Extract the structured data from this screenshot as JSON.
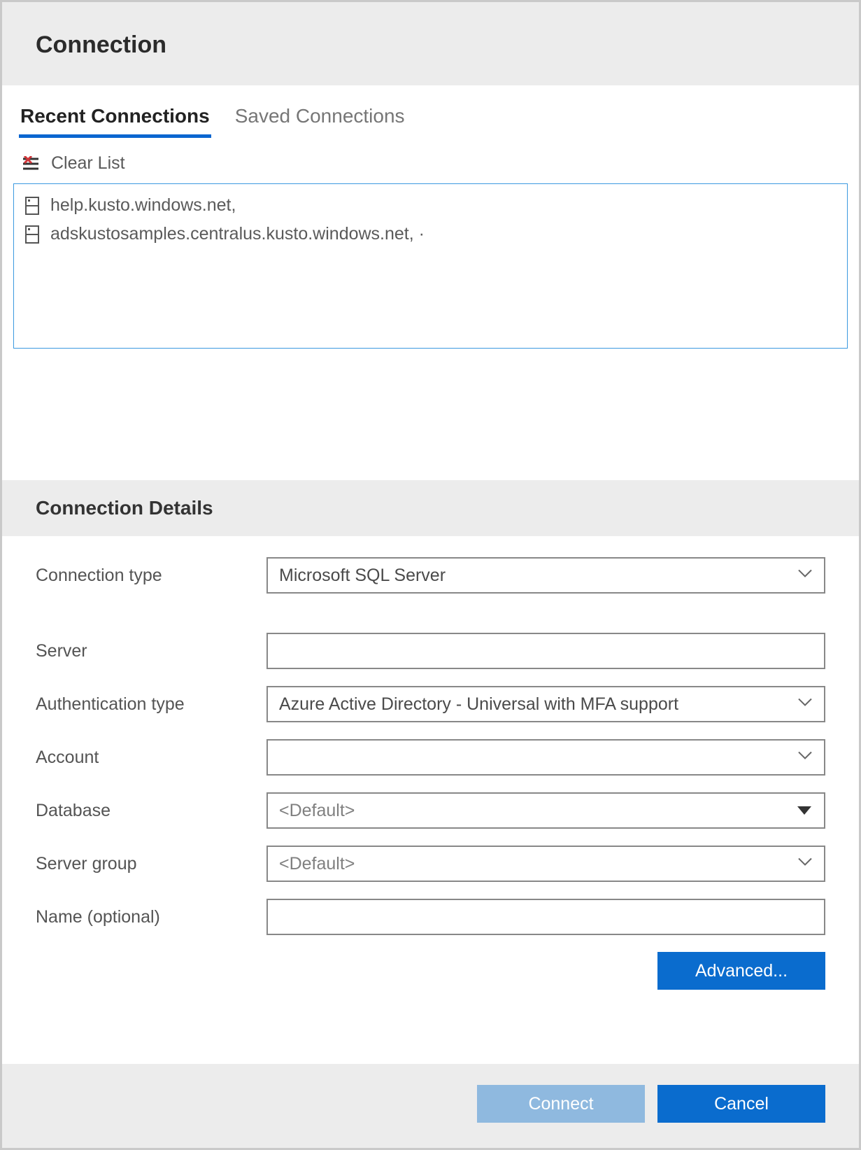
{
  "header": {
    "title": "Connection"
  },
  "tabs": {
    "recent": "Recent Connections",
    "saved": "Saved Connections"
  },
  "clear_list": "Clear List",
  "recent_connections": [
    {
      "label": "help.kusto.windows.net,"
    },
    {
      "label": "adskustosamples.centralus.kusto.windows.net, ·"
    }
  ],
  "details_header": "Connection Details",
  "form": {
    "connection_type": {
      "label": "Connection type",
      "value": "Microsoft SQL Server"
    },
    "server": {
      "label": "Server",
      "value": ""
    },
    "auth_type": {
      "label": "Authentication type",
      "value": "Azure Active Directory - Universal with MFA support"
    },
    "account": {
      "label": "Account",
      "value": ""
    },
    "database": {
      "label": "Database",
      "placeholder": "<Default>"
    },
    "server_group": {
      "label": "Server group",
      "placeholder": "<Default>"
    },
    "name_optional": {
      "label": "Name (optional)",
      "value": ""
    }
  },
  "buttons": {
    "advanced": "Advanced...",
    "connect": "Connect",
    "cancel": "Cancel"
  }
}
